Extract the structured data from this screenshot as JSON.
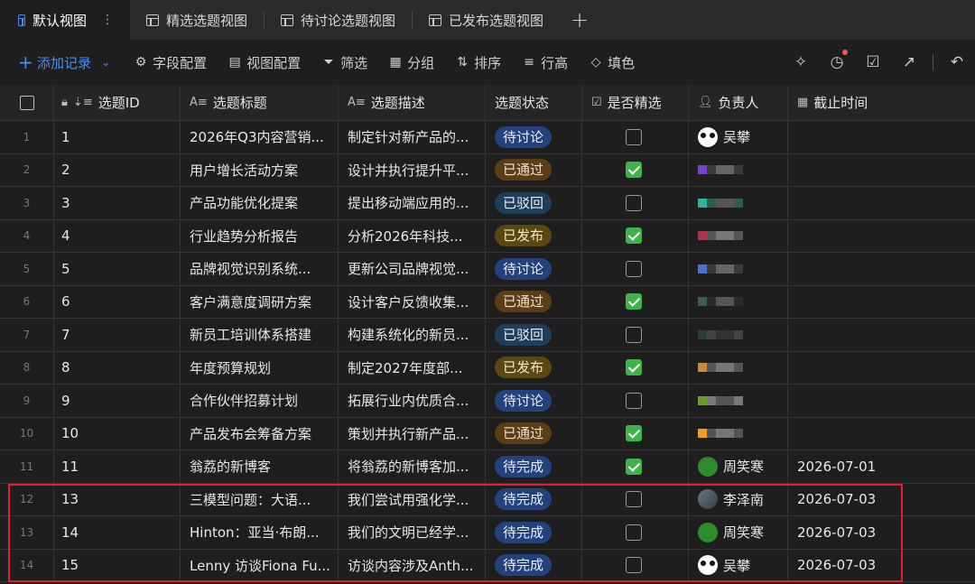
{
  "tabs": [
    {
      "label": "默认视图",
      "active": true
    },
    {
      "label": "精选选题视图",
      "active": false
    },
    {
      "label": "待讨论选题视图",
      "active": false
    },
    {
      "label": "已发布选题视图",
      "active": false
    }
  ],
  "toolbar": {
    "add_record": "添加记录",
    "field_config": "字段配置",
    "view_config": "视图配置",
    "filter": "筛选",
    "group": "分组",
    "sort": "排序",
    "row_height": "行高",
    "fill_color": "填色"
  },
  "columns": {
    "id": "选题ID",
    "title": "选题标题",
    "desc": "选题描述",
    "status": "选题状态",
    "featured": "是否精选",
    "owner": "负责人",
    "deadline": "截止时间"
  },
  "rows": [
    {
      "row": "1",
      "id": "1",
      "title": "2026年Q3内容营销...",
      "desc": "制定针对新产品的...",
      "status": "待讨论",
      "status_type": "discuss",
      "featured": false,
      "owner": "吴攀",
      "owner_avatar": "panda",
      "deadline": ""
    },
    {
      "row": "2",
      "id": "2",
      "title": "用户增长活动方案",
      "desc": "设计并执行提升平...",
      "status": "已通过",
      "status_type": "passed",
      "featured": true,
      "owner": "",
      "owner_avatar": "blurred",
      "deadline": ""
    },
    {
      "row": "3",
      "id": "3",
      "title": "产品功能优化提案",
      "desc": "提出移动端应用的...",
      "status": "已驳回",
      "status_type": "rejected",
      "featured": false,
      "owner": "",
      "owner_avatar": "blurred",
      "deadline": ""
    },
    {
      "row": "4",
      "id": "4",
      "title": "行业趋势分析报告",
      "desc": "分析2026年科技...",
      "status": "已发布",
      "status_type": "published",
      "featured": true,
      "owner": "",
      "owner_avatar": "blurred",
      "deadline": ""
    },
    {
      "row": "5",
      "id": "5",
      "title": "品牌视觉识别系统...",
      "desc": "更新公司品牌视觉...",
      "status": "待讨论",
      "status_type": "discuss",
      "featured": false,
      "owner": "",
      "owner_avatar": "blurred",
      "deadline": ""
    },
    {
      "row": "6",
      "id": "6",
      "title": "客户满意度调研方案",
      "desc": "设计客户反馈收集...",
      "status": "已通过",
      "status_type": "passed",
      "featured": true,
      "owner": "",
      "owner_avatar": "blurred",
      "deadline": ""
    },
    {
      "row": "7",
      "id": "7",
      "title": "新员工培训体系搭建",
      "desc": "构建系统化的新员...",
      "status": "已驳回",
      "status_type": "rejected",
      "featured": false,
      "owner": "",
      "owner_avatar": "blurred",
      "deadline": ""
    },
    {
      "row": "8",
      "id": "8",
      "title": "年度预算规划",
      "desc": "制定2027年度部...",
      "status": "已发布",
      "status_type": "published",
      "featured": true,
      "owner": "",
      "owner_avatar": "blurred",
      "deadline": ""
    },
    {
      "row": "9",
      "id": "9",
      "title": "合作伙伴招募计划",
      "desc": "拓展行业内优质合...",
      "status": "待讨论",
      "status_type": "discuss",
      "featured": false,
      "owner": "",
      "owner_avatar": "blurred",
      "deadline": ""
    },
    {
      "row": "10",
      "id": "10",
      "title": "产品发布会筹备方案",
      "desc": "策划并执行新产品...",
      "status": "已通过",
      "status_type": "passed",
      "featured": true,
      "owner": "",
      "owner_avatar": "blurred",
      "deadline": ""
    },
    {
      "row": "11",
      "id": "11",
      "title": "翁荔的新博客",
      "desc": "将翁荔的新博客加...",
      "status": "待完成",
      "status_type": "todo",
      "featured": true,
      "owner": "周笑寒",
      "owner_avatar": "green",
      "deadline": "2026-07-01"
    },
    {
      "row": "12",
      "id": "13",
      "title": "三模型问题：大语...",
      "desc": "我们尝试用强化学...",
      "status": "待完成",
      "status_type": "todo",
      "featured": false,
      "owner": "李泽南",
      "owner_avatar": "photo",
      "deadline": "2026-07-03"
    },
    {
      "row": "13",
      "id": "14",
      "title": "Hinton：亚当·布朗...",
      "desc": "我们的文明已经学...",
      "status": "待完成",
      "status_type": "todo",
      "featured": false,
      "owner": "周笑寒",
      "owner_avatar": "green",
      "deadline": "2026-07-03"
    },
    {
      "row": "14",
      "id": "15",
      "title": "Lenny 访谈Fiona Fu...",
      "desc": "访谈内容涉及Anth...",
      "status": "待完成",
      "status_type": "todo",
      "featured": false,
      "owner": "吴攀",
      "owner_avatar": "panda",
      "deadline": "2026-07-03"
    }
  ],
  "colors": {
    "accent": "#4a8cf7",
    "check_green": "#3db34a",
    "highlight_red": "#e0202a"
  }
}
